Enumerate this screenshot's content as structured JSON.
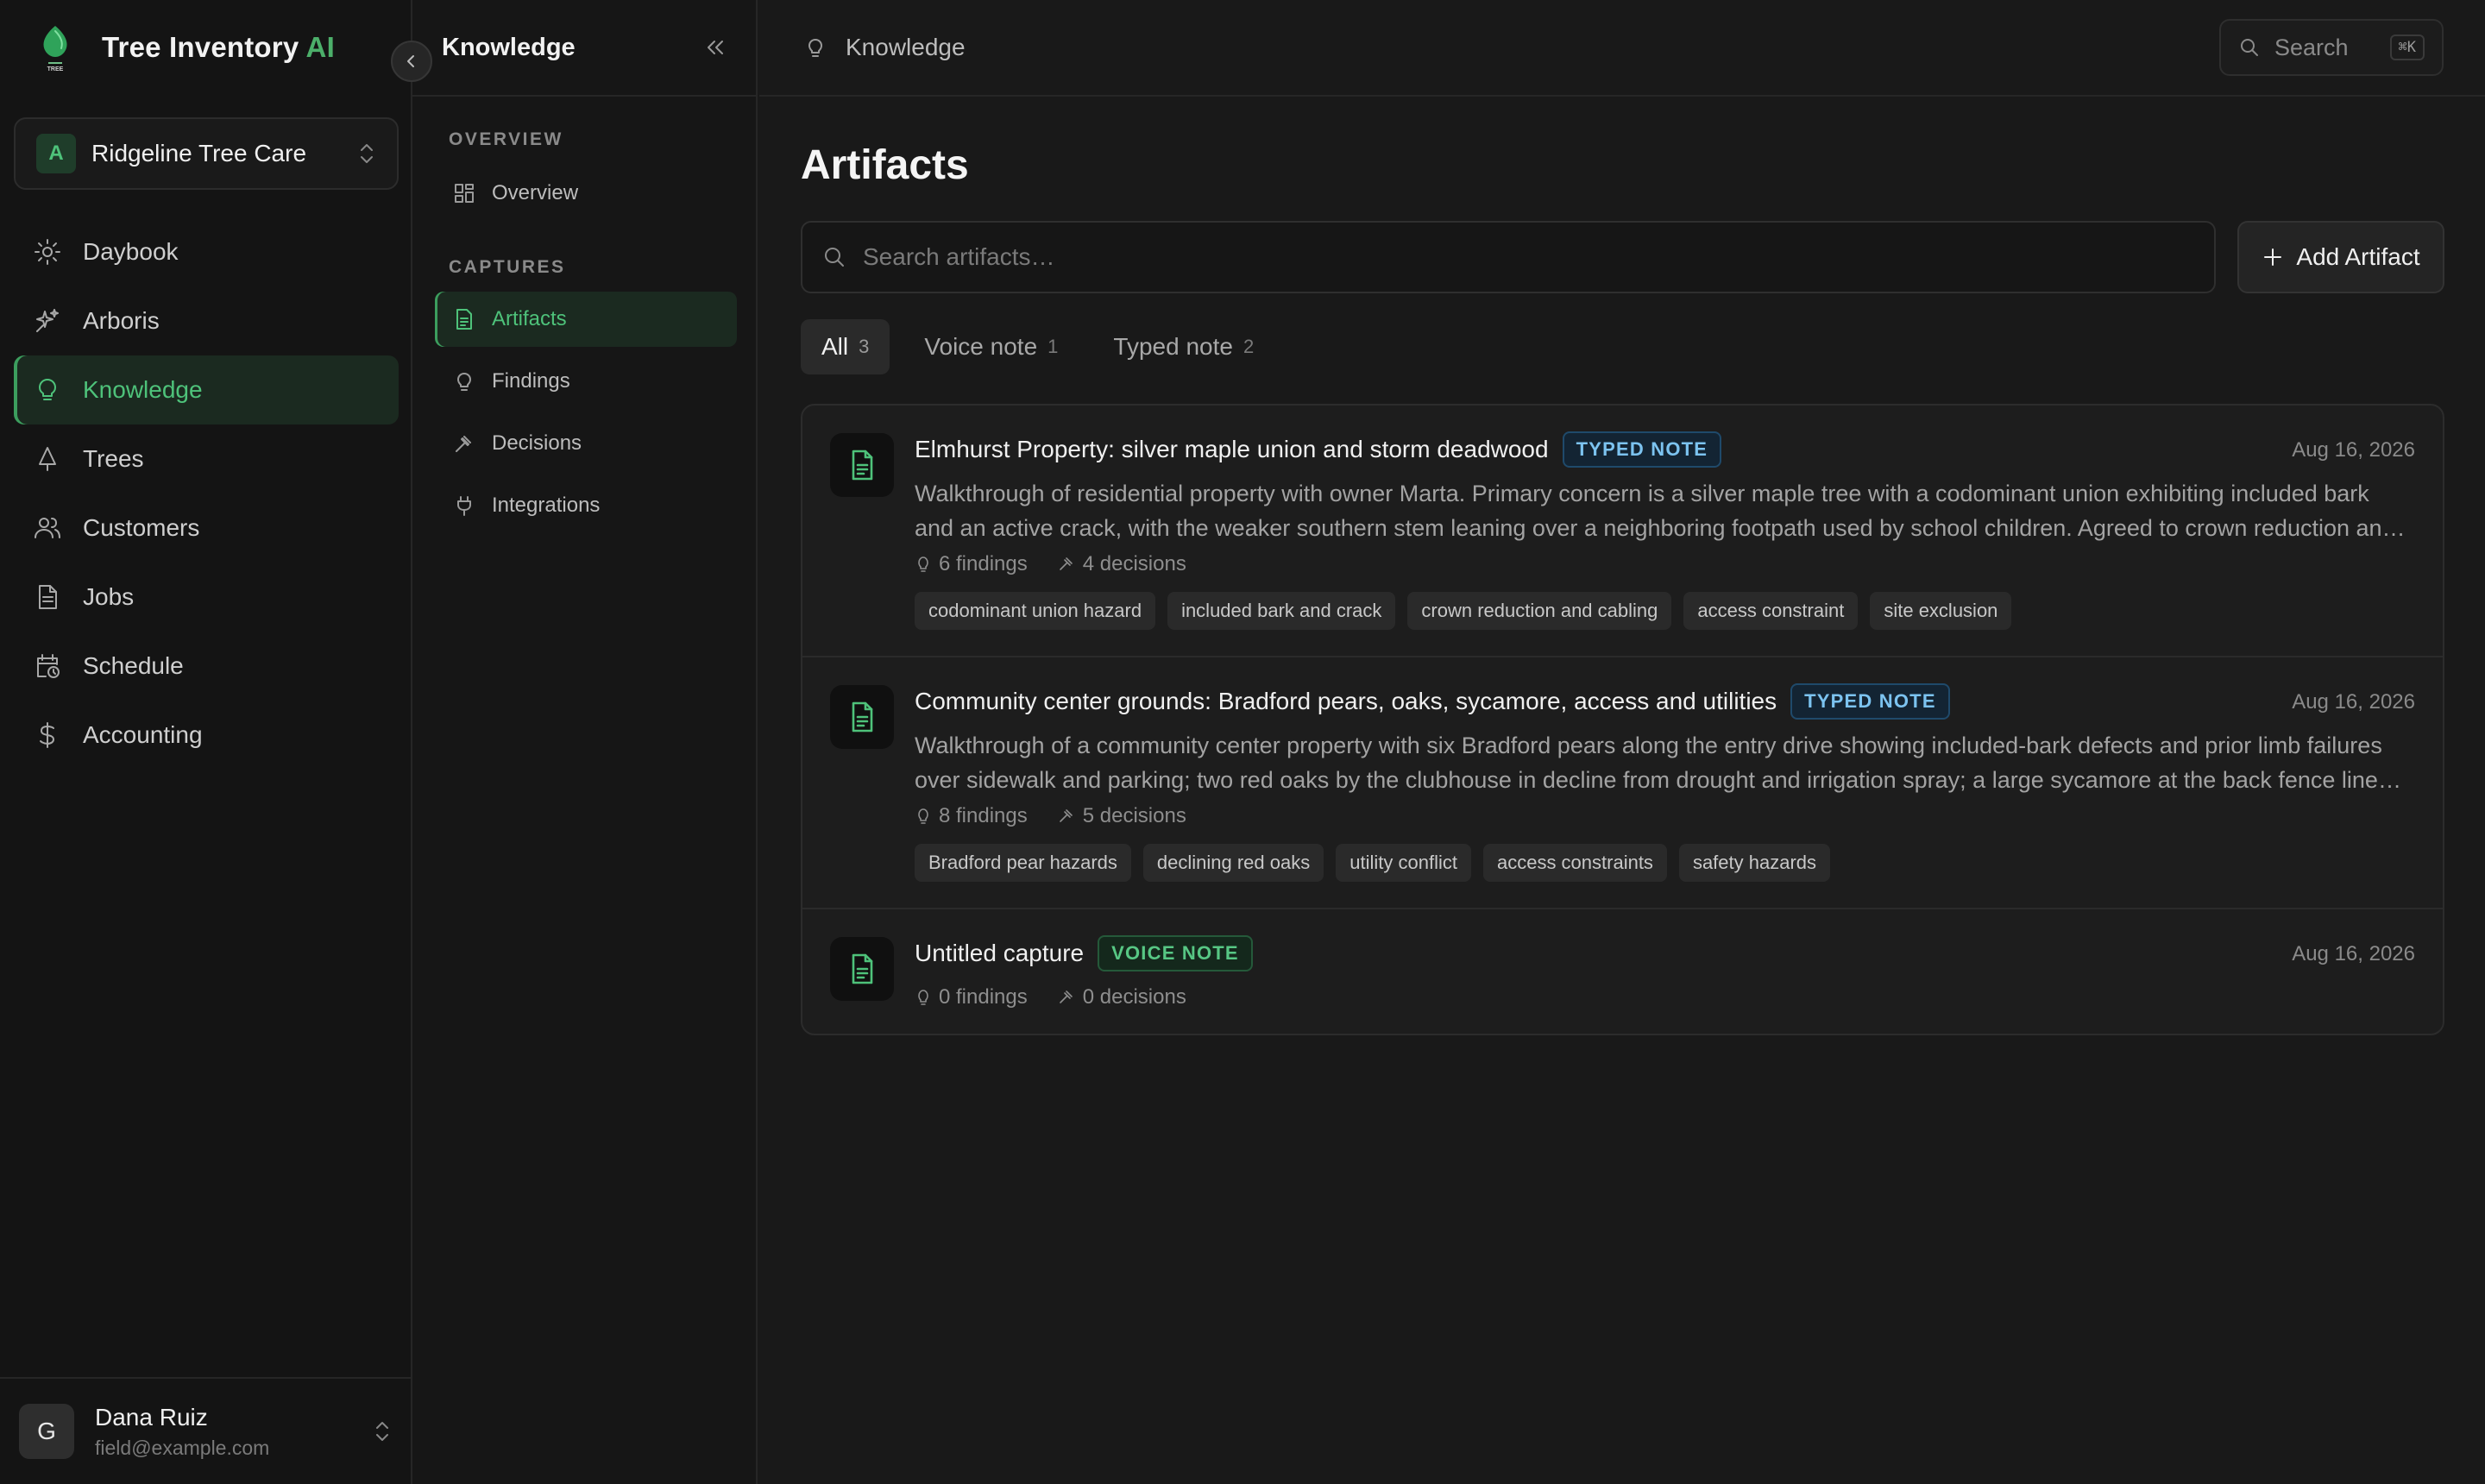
{
  "brand": {
    "name": "Tree Inventory",
    "suffix": "AI",
    "logo_text": "TREE"
  },
  "org": {
    "initial": "A",
    "name": "Ridgeline Tree Care"
  },
  "nav": {
    "items": [
      {
        "label": "Daybook",
        "icon": "sun-icon"
      },
      {
        "label": "Arboris",
        "icon": "sparkles-icon"
      },
      {
        "label": "Knowledge",
        "icon": "lightbulb-icon",
        "active": true
      },
      {
        "label": "Trees",
        "icon": "tree-icon"
      },
      {
        "label": "Customers",
        "icon": "users-icon"
      },
      {
        "label": "Jobs",
        "icon": "file-icon"
      },
      {
        "label": "Schedule",
        "icon": "calendar-clock-icon"
      },
      {
        "label": "Accounting",
        "icon": "dollar-icon"
      }
    ]
  },
  "user": {
    "initial": "G",
    "name": "Dana Ruiz",
    "email": "field@example.com"
  },
  "subnav": {
    "title": "Knowledge",
    "sections": [
      {
        "label": "OVERVIEW",
        "items": [
          {
            "label": "Overview"
          }
        ]
      },
      {
        "label": "CAPTURES",
        "items": [
          {
            "label": "Artifacts",
            "active": true
          },
          {
            "label": "Findings"
          },
          {
            "label": "Decisions"
          },
          {
            "label": "Integrations"
          }
        ]
      }
    ]
  },
  "topbar": {
    "breadcrumb": "Knowledge",
    "search_label": "Search",
    "search_shortcut": "⌘K"
  },
  "main": {
    "title": "Artifacts",
    "search_placeholder": "Search artifacts…",
    "add_label": "Add Artifact",
    "tabs": [
      {
        "label": "All",
        "count": "3",
        "active": true
      },
      {
        "label": "Voice note",
        "count": "1"
      },
      {
        "label": "Typed note",
        "count": "2"
      }
    ],
    "artifacts": [
      {
        "title": "Elmhurst Property: silver maple union and storm deadwood",
        "badge": "TYPED NOTE",
        "badge_kind": "typed",
        "date": "Aug 16, 2026",
        "description": "Walkthrough of residential property with owner Marta. Primary concern is a silver maple tree with a codominant union exhibiting included bark and an active crack, with the weaker southern stem leaning over a neighboring footpath used by school children. Agreed to crown reduction and cabling with access constraints noted.",
        "findings": "6 findings",
        "decisions": "4 decisions",
        "tags": [
          "codominant union hazard",
          "included bark and crack",
          "crown reduction and cabling",
          "access constraint",
          "site exclusion"
        ]
      },
      {
        "title": "Community center grounds: Bradford pears, oaks, sycamore, access and utilities",
        "badge": "TYPED NOTE",
        "badge_kind": "typed",
        "date": "Aug 16, 2026",
        "description": "Walkthrough of a community center property with six Bradford pears along the entry drive showing included-bark defects and prior limb failures over sidewalk and parking; two red oaks by the clubhouse in decline from drought and irrigation spray; a large sycamore at the back fence line near overhead utility lines.",
        "findings": "8 findings",
        "decisions": "5 decisions",
        "tags": [
          "Bradford pear hazards",
          "declining red oaks",
          "utility conflict",
          "access constraints",
          "safety hazards"
        ]
      },
      {
        "title": "Untitled capture",
        "badge": "VOICE NOTE",
        "badge_kind": "voice",
        "date": "Aug 16, 2026",
        "description": "",
        "findings": "0 findings",
        "decisions": "0 decisions",
        "tags": []
      }
    ]
  },
  "colors": {
    "accent": "#4ec27a",
    "background": "#191919",
    "sidebar": "#141414",
    "typed_badge": "#7cc3f0",
    "voice_badge": "#57c784"
  }
}
